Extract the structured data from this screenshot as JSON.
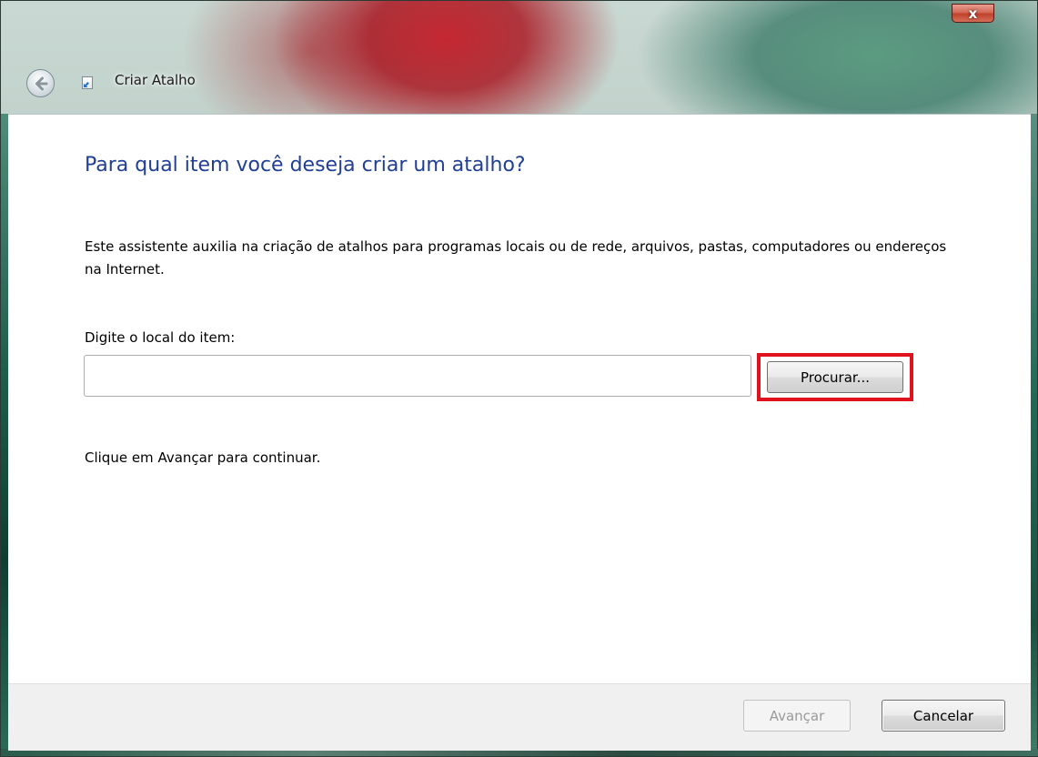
{
  "window": {
    "title": "Criar Atalho",
    "close_label": "x"
  },
  "wizard": {
    "heading": "Para qual item você deseja criar um atalho?",
    "description": "Este assistente auxilia na criação de atalhos para programas locais ou de rede, arquivos, pastas, computadores ou endereços na Internet.",
    "location_label": "Digite o local do item:",
    "location_value": "",
    "browse_label": "Procurar...",
    "hint": "Clique em Avançar para continuar."
  },
  "footer": {
    "next_label": "Avançar",
    "cancel_label": "Cancelar"
  },
  "colors": {
    "heading": "#1f3f96",
    "highlight": "#e0121e",
    "close_button": "#c2412b"
  },
  "icons": {
    "back": "back-arrow-icon",
    "shortcut": "shortcut-icon",
    "close": "close-icon"
  }
}
